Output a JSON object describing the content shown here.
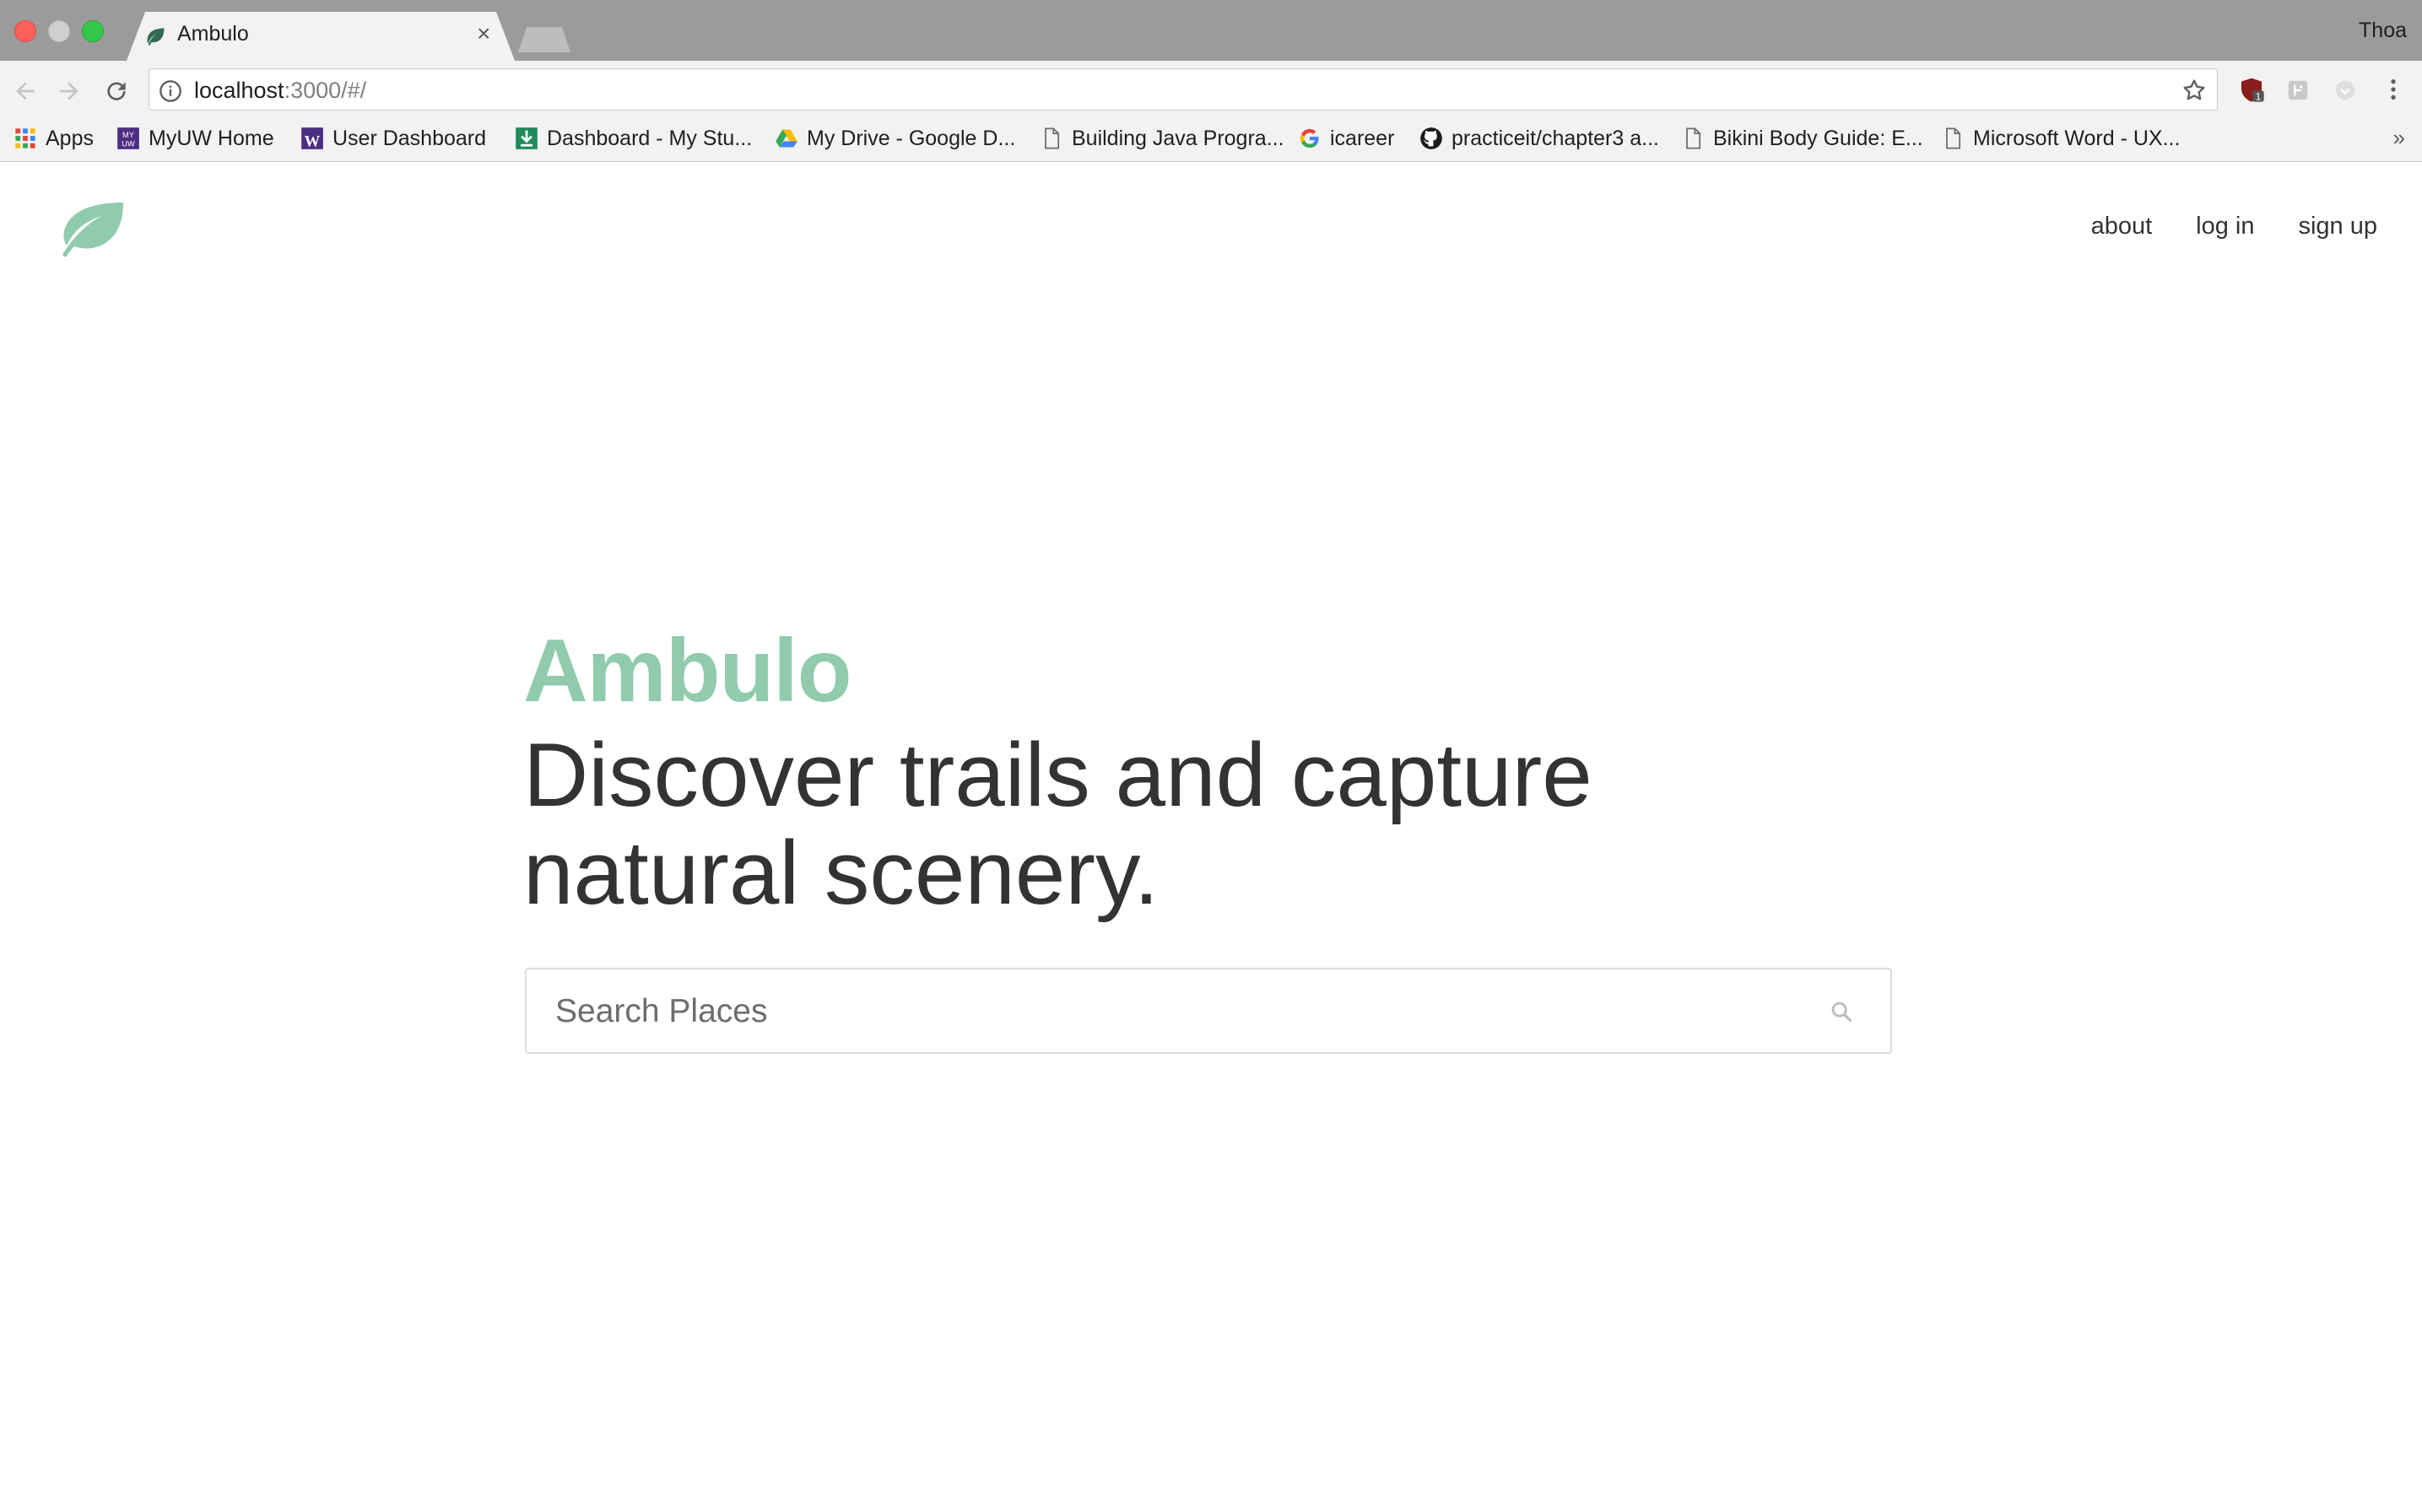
{
  "browser": {
    "tab": {
      "title": "Ambulo",
      "close_glyph": "×",
      "favicon": "leaf-icon"
    },
    "profile_name": "Thoa",
    "address": {
      "host": "localhost",
      "rest": ":3000/#/"
    },
    "bookmarks_more_glyph": "»",
    "bookmarks": [
      {
        "label": "Apps",
        "icon": "apps-grid-icon"
      },
      {
        "label": "MyUW Home",
        "icon": "myuw-icon"
      },
      {
        "label": "User Dashboard",
        "icon": "w-logo-icon"
      },
      {
        "label": "Dashboard - My Stu...",
        "icon": "download-icon"
      },
      {
        "label": "My Drive - Google D...",
        "icon": "google-drive-icon"
      },
      {
        "label": "Building Java Progra...",
        "icon": "page-icon"
      },
      {
        "label": "icareer",
        "icon": "google-icon"
      },
      {
        "label": "practiceit/chapter3 a...",
        "icon": "github-icon"
      },
      {
        "label": "Bikini Body Guide: E...",
        "icon": "page-icon"
      },
      {
        "label": "Microsoft Word - UX...",
        "icon": "page-icon"
      }
    ],
    "extension_badge": "1"
  },
  "nav": {
    "about": "about",
    "login": "log in",
    "signup": "sign up"
  },
  "hero": {
    "brand": "Ambulo",
    "tagline": "Discover trails and capture natural scenery."
  },
  "search": {
    "placeholder": "Search Places"
  },
  "colors": {
    "brand_green": "#8fcbac",
    "text_dark": "#333333"
  }
}
